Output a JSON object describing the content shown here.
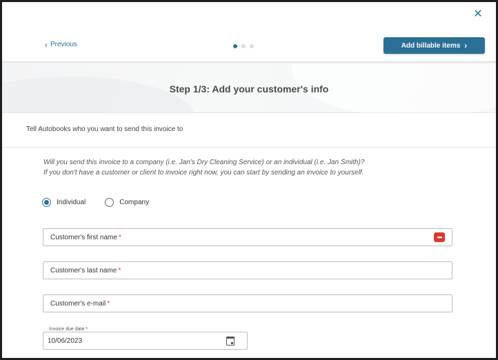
{
  "header": {
    "close_icon": "close-icon",
    "previous_label": "Previous",
    "next_label": "Add billable items",
    "steps_total": 3,
    "steps_active": 1
  },
  "banner": {
    "title": "Step 1/3: Add your customer's info"
  },
  "section": {
    "label": "Tell Autobooks who you want to send this invoice to"
  },
  "instructions": {
    "line1": "Will you send this invoice to a company (i.e. Jan's Dry Cleaning Service) or an individual (i.e. Jan Smith)?",
    "line2": "If you don't have a customer or client to invoice right now, you can start by sending an invoice to yourself."
  },
  "customer_type": {
    "options": [
      {
        "label": "Individual",
        "checked": true
      },
      {
        "label": "Company",
        "checked": false
      }
    ]
  },
  "fields": {
    "first_name_label": "Customer's first name",
    "last_name_label": "Customer's last name",
    "email_label": "Customer's e-mail",
    "required_mark": "*",
    "autofill_icon": "password-manager-icon",
    "autofill_glyph": "•••"
  },
  "due_date": {
    "label": "Invoice due date *",
    "value": "10/06/2023",
    "icon": "calendar-icon"
  },
  "colors": {
    "accent": "#2b6f96",
    "required": "#d43b2b",
    "autofill": "#d93a2b"
  }
}
